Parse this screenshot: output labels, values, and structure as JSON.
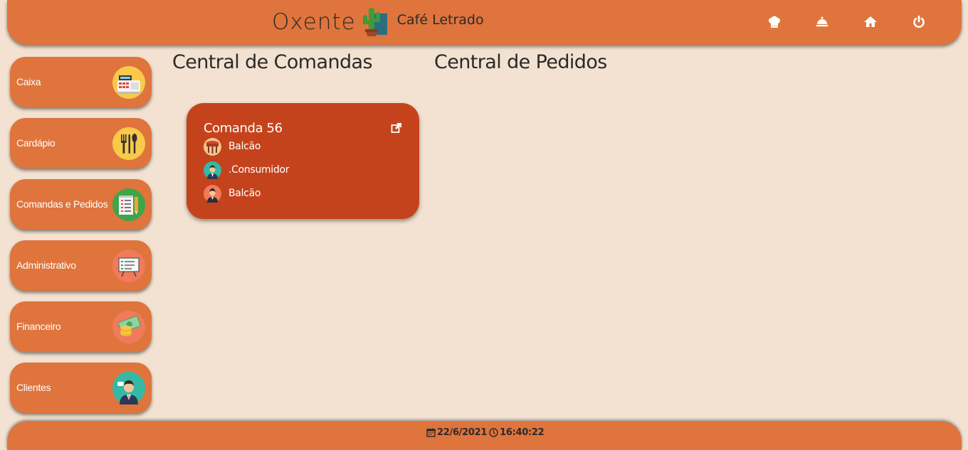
{
  "header": {
    "brand_name": "Oxente",
    "brand_subtitle": "Café Letrado",
    "icons": [
      "chef-hat-icon",
      "service-bell-icon",
      "home-icon",
      "power-icon"
    ]
  },
  "sidebar": {
    "items": [
      {
        "label": "Caixa",
        "icon": "cash-register-icon"
      },
      {
        "label": "Cardápio",
        "icon": "cutlery-icon"
      },
      {
        "label": "Comandas e Pedidos",
        "icon": "notepad-icon"
      },
      {
        "label": "Administrativo",
        "icon": "presentation-board-icon"
      },
      {
        "label": "Financeiro",
        "icon": "money-icon"
      },
      {
        "label": "Clientes",
        "icon": "customer-icon"
      }
    ]
  },
  "main": {
    "comandas_title": "Central de Comandas",
    "pedidos_title": "Central de Pedidos",
    "comanda_card": {
      "title": "Comanda 56",
      "rows": [
        {
          "text": "Balcão",
          "icon": "table-icon"
        },
        {
          "text": ".Consumidor",
          "icon": "customer-avatar-icon"
        },
        {
          "text": "Balcão",
          "icon": "waiter-avatar-icon"
        }
      ]
    }
  },
  "footer": {
    "date": "22/6/2021",
    "time": "16:40:22"
  },
  "colors": {
    "background": "#f3e2d1",
    "accent": "#df743c",
    "card": "#c5431c"
  }
}
